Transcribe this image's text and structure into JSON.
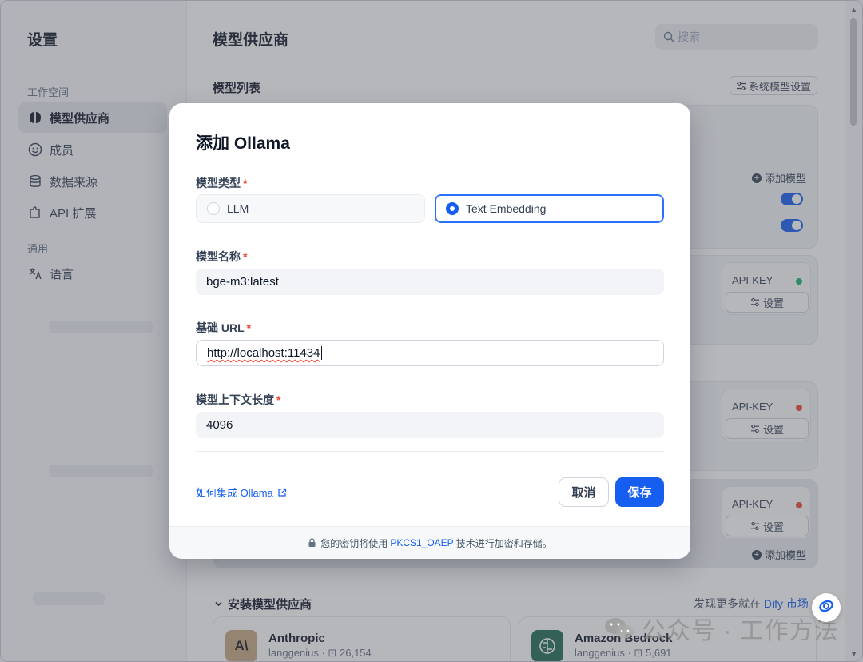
{
  "sidebar": {
    "title": "设置",
    "section_workspace": "工作空间",
    "section_general": "通用",
    "items": [
      {
        "label": "模型供应商"
      },
      {
        "label": "成员"
      },
      {
        "label": "数据来源"
      },
      {
        "label": "API 扩展"
      },
      {
        "label": "语言"
      }
    ]
  },
  "header": {
    "title": "模型供应商",
    "search_placeholder": "搜索"
  },
  "model_list": {
    "title": "模型列表",
    "system_settings_label": "系统模型设置",
    "add_model_label": "添加模型",
    "api_key_label": "API-KEY",
    "settings_label": "设置",
    "status_colors": [
      "#12b76a",
      "#f04438",
      "#f04438"
    ]
  },
  "install": {
    "title": "安装模型供应商",
    "discover_prefix": "发现更多就在",
    "discover_link": "Dify 市场",
    "providers": [
      {
        "name": "Anthropic",
        "author": "langgenius",
        "installs": "26,154",
        "logo_text": "A\\"
      },
      {
        "name": "Amazon Bedrock",
        "author": "langgenius",
        "installs": "5,691"
      }
    ]
  },
  "modal": {
    "title": "添加 Ollama",
    "model_type_label": "模型类型",
    "model_type_options": [
      "LLM",
      "Text Embedding"
    ],
    "model_type_selected": "Text Embedding",
    "model_name_label": "模型名称",
    "model_name_value": "bge-m3:latest",
    "base_url_label": "基础 URL",
    "base_url_value": "http://localhost:11434",
    "context_length_label": "模型上下文长度",
    "context_length_value": "4096",
    "required_mark": "*",
    "help_link": "如何集成 Ollama",
    "cancel_label": "取消",
    "save_label": "保存",
    "footer_prefix": "您的密钥将使用",
    "footer_highlight": "PKCS1_OAEP",
    "footer_suffix": "技术进行加密和存储。",
    "accent_color": "#155eef"
  },
  "watermark": {
    "text": "公众号 · 工作方法"
  }
}
